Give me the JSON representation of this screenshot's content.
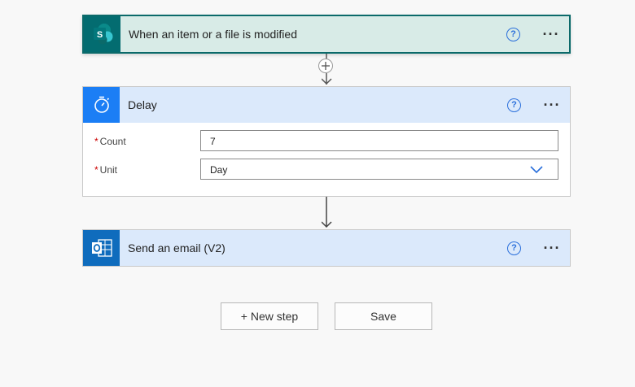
{
  "trigger": {
    "title": "When an item or a file is modified",
    "icon": "sharepoint-icon",
    "help": "?",
    "more": "···"
  },
  "delay": {
    "title": "Delay",
    "icon": "stopwatch-icon",
    "help": "?",
    "more": "···",
    "fields": [
      {
        "label": "Count",
        "required_mark": "*",
        "value": "7"
      },
      {
        "label": "Unit",
        "required_mark": "*",
        "value": "Day"
      }
    ]
  },
  "email": {
    "title": "Send an email (V2)",
    "icon": "outlook-icon",
    "help": "?",
    "more": "···"
  },
  "actions": {
    "new_step": "+ New step",
    "save": "Save"
  },
  "colors": {
    "trigger_header": "#d8ebe7",
    "trigger_icon_bg": "#036c70",
    "delay_icon_bg": "#1b7ef5",
    "action_header": "#dbe9fb",
    "outlook_icon_bg": "#0f6cbd",
    "accent": "#2a6fdb"
  }
}
